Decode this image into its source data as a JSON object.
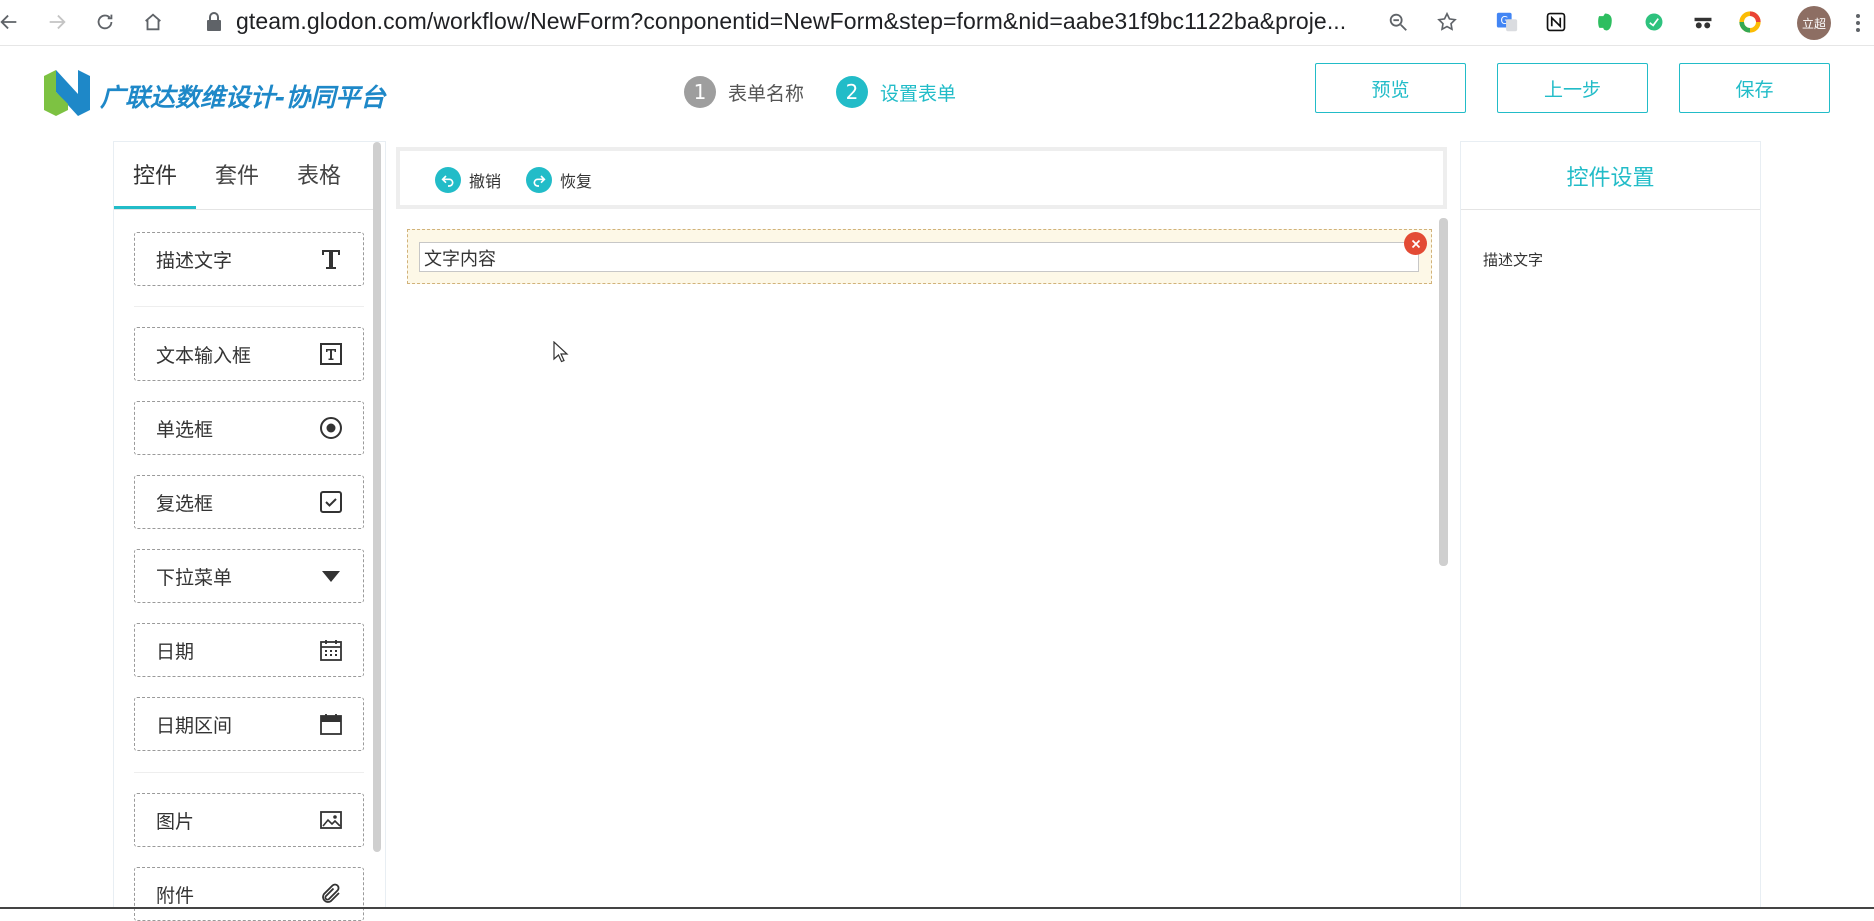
{
  "browser": {
    "url": "gteam.glodon.com/workflow/NewForm?conponentid=NewForm&step=form&nid=aabe31f9bc1122ba&proje...",
    "avatar_label": "立超"
  },
  "header": {
    "logo_text": "广联达数维设计-协同平台",
    "steps": [
      {
        "number": "1",
        "label": "表单名称"
      },
      {
        "number": "2",
        "label": "设置表单"
      }
    ],
    "buttons": {
      "preview": "预览",
      "prev": "上一步",
      "save": "保存"
    }
  },
  "left_panel": {
    "tabs": [
      "控件",
      "套件",
      "表格"
    ],
    "active_tab": 0,
    "widgets": [
      {
        "label": "描述文字",
        "icon": "text-t-icon"
      },
      {
        "label": "文本输入框",
        "icon": "text-box-icon"
      },
      {
        "label": "单选框",
        "icon": "radio-icon"
      },
      {
        "label": "复选框",
        "icon": "checkbox-icon"
      },
      {
        "label": "下拉菜单",
        "icon": "dropdown-triangle-icon"
      },
      {
        "label": "日期",
        "icon": "calendar-icon"
      },
      {
        "label": "日期区间",
        "icon": "calendar-range-icon"
      },
      {
        "label": "图片",
        "icon": "image-icon"
      },
      {
        "label": "附件",
        "icon": "paperclip-icon"
      }
    ]
  },
  "toolbar": {
    "undo_label": "撤销",
    "redo_label": "恢复"
  },
  "canvas": {
    "field_value": "文字内容"
  },
  "right_panel": {
    "title": "控件设置",
    "label": "描述文字"
  },
  "colors": {
    "accent": "#22bcc8",
    "step_inactive": "#9e9e9e",
    "delete": "#e34b34",
    "selected_row_bg": "#fdf8e7"
  }
}
